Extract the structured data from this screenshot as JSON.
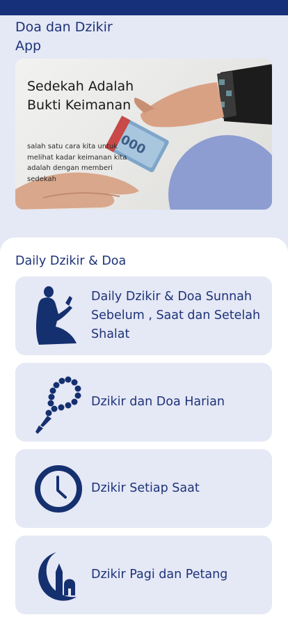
{
  "app": {
    "title": "Doa dan Dzikir App"
  },
  "banner": {
    "title": "Sedekah Adalah Bukti Keimanan",
    "subtitle": "salah satu cara kita untuk melihat kadar keimanan kita adalah dengan memberi sedekah"
  },
  "section": {
    "title": "Daily Dzikir & Doa"
  },
  "menu": [
    {
      "label": "Daily Dzikir & Doa Sunnah Sebelum , Saat dan Setelah Shalat",
      "icon": "praying-man-icon"
    },
    {
      "label": "Dzikir dan Doa Harian",
      "icon": "prayer-beads-icon"
    },
    {
      "label": "Dzikir Setiap Saat",
      "icon": "clock-icon"
    },
    {
      "label": "Dzikir Pagi dan Petang",
      "icon": "crescent-mosque-icon"
    }
  ],
  "colors": {
    "primary": "#1d3378",
    "background": "#e5e8f5",
    "status_bar": "#16307a",
    "banner_accent": "#8d9dd1"
  }
}
